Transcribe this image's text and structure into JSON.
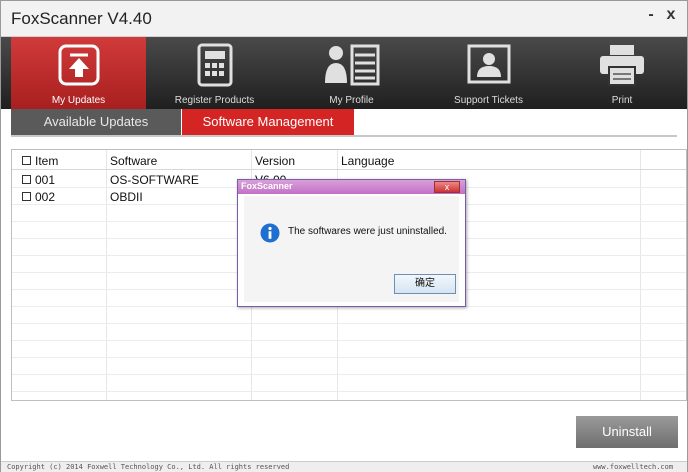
{
  "window": {
    "title": "FoxScanner  V4.40",
    "minimize_glyph": "-",
    "close_glyph": "x"
  },
  "toolbar": {
    "items": [
      {
        "label": "My Updates",
        "icon": "upload-arrow-icon"
      },
      {
        "label": "Register Products",
        "icon": "calculator-icon"
      },
      {
        "label": "My Profile",
        "icon": "profile-list-icon"
      },
      {
        "label": "Support Tickets",
        "icon": "contact-card-icon"
      },
      {
        "label": "Print",
        "icon": "printer-icon"
      }
    ],
    "active": "My Updates"
  },
  "subtabs": {
    "available": "Available Updates",
    "software": "Software Management",
    "active": "Software Management"
  },
  "table": {
    "headers": {
      "item": "Item",
      "software": "Software",
      "version": "Version",
      "language": "Language"
    },
    "rows": [
      {
        "item": "001",
        "software": "OS-SOFTWARE",
        "version": "V6.00"
      },
      {
        "item": "002",
        "software": "OBDII",
        "version": ""
      }
    ]
  },
  "dialog": {
    "title": "FoxScanner",
    "close_glyph": "x",
    "message": "The softwares were just uninstalled.",
    "ok_label": "确定",
    "icon": "info-icon"
  },
  "buttons": {
    "uninstall": "Uninstall"
  },
  "footer": {
    "copyright": "Copyright (c) 2014 Foxwell Technology Co., Ltd. All rights reserved",
    "website": "www.foxwelltech.com"
  },
  "colors": {
    "accent": "#d42424",
    "toolbar_bg": "#2f2f2f",
    "dialog_title": "#c270c7"
  }
}
